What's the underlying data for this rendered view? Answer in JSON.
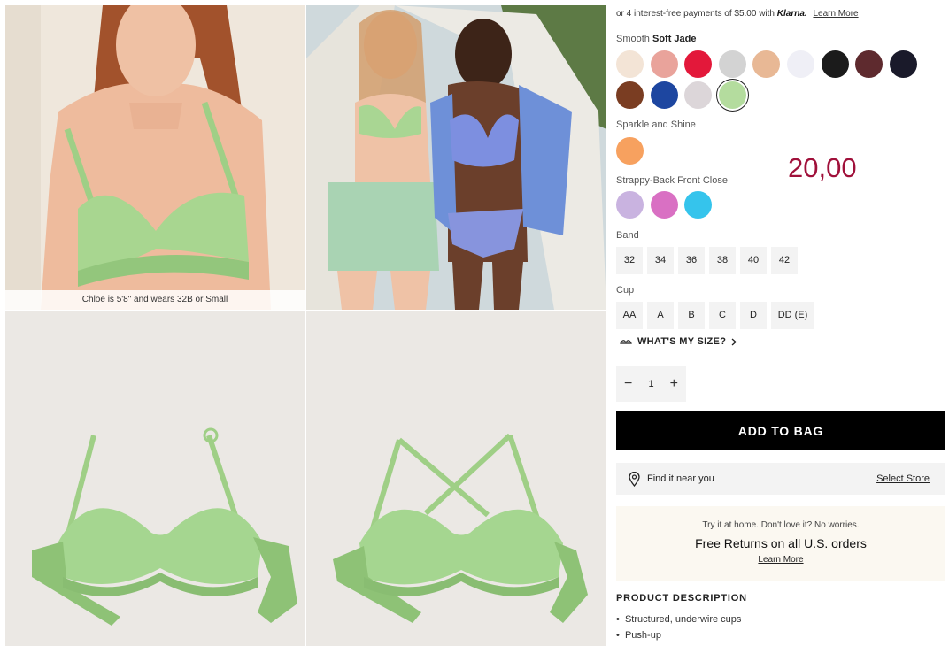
{
  "gallery": {
    "caption": "Chloe is 5'8\" and wears 32B or Small"
  },
  "klarna": {
    "text": "or 4 interest-free payments of $5.00 with",
    "brand": "Klarna.",
    "link": "Learn More"
  },
  "colors": {
    "group_label": "Smooth",
    "selected_name": "Soft Jade",
    "smooth": [
      "#f3e4d6",
      "#e9a39b",
      "#e3183a",
      "#d3d3d3",
      "#e8b895",
      "#efeff6",
      "#1b1b1b",
      "#5e2a2e",
      "#1a1a2a",
      "#7a3d22",
      "#1d46a0",
      "#dcd6d9",
      "#b4dc9e"
    ],
    "sparkle_label": "Sparkle and Shine",
    "sparkle": [
      "#f7a15f"
    ],
    "strappy_label": "Strappy-Back Front Close",
    "strappy": [
      "#c9b3e0",
      "#d970c3",
      "#35c4ec"
    ]
  },
  "price": "20,00",
  "band": {
    "label": "Band",
    "options": [
      "32",
      "34",
      "36",
      "38",
      "40",
      "42"
    ]
  },
  "cup": {
    "label": "Cup",
    "options": [
      "AA",
      "A",
      "B",
      "C",
      "D",
      "DD (E)"
    ]
  },
  "size_help": "WHAT'S MY SIZE?",
  "quantity": {
    "minus": "−",
    "value": "1",
    "plus": "+"
  },
  "add_to_bag": "ADD TO BAG",
  "store": {
    "text": "Find it near you",
    "link": "Select Store"
  },
  "returns": {
    "line1": "Try it at home. Don't love it? No worries.",
    "line2": "Free Returns on all U.S. orders",
    "link": "Learn More"
  },
  "description": {
    "heading": "PRODUCT DESCRIPTION",
    "bullets": [
      "Structured, underwire cups",
      "Push-up"
    ]
  },
  "accent": "#a0103a"
}
